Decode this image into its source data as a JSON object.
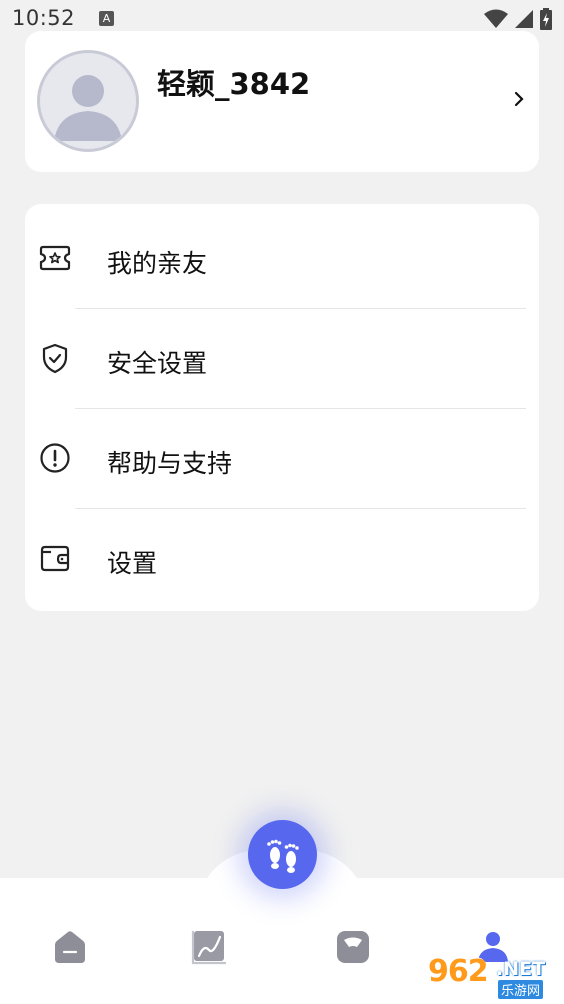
{
  "status_bar": {
    "time": "10:52",
    "notification_letter": "A"
  },
  "profile": {
    "username": "轻颖_3842"
  },
  "menu": {
    "items": [
      {
        "label": "我的亲友",
        "icon": "ticket-star-icon"
      },
      {
        "label": "安全设置",
        "icon": "shield-check-icon"
      },
      {
        "label": "帮助与支持",
        "icon": "info-circle-icon"
      },
      {
        "label": "设置",
        "icon": "wallet-icon"
      }
    ]
  },
  "bottom_nav": {
    "items": [
      {
        "name": "home",
        "icon": "home-icon",
        "active": false
      },
      {
        "name": "stats",
        "icon": "chart-icon",
        "active": false
      },
      {
        "name": "scale",
        "icon": "scale-icon",
        "active": false
      },
      {
        "name": "profile",
        "icon": "person-icon",
        "active": true
      }
    ],
    "fab_icon": "footprints-icon"
  },
  "watermark": {
    "number": "962",
    "suffix": ".NET",
    "sub": "乐游网"
  },
  "colors": {
    "accent": "#5768ee",
    "background": "#f1f1f1",
    "card": "#ffffff",
    "icon_gray": "#8e8e99"
  }
}
